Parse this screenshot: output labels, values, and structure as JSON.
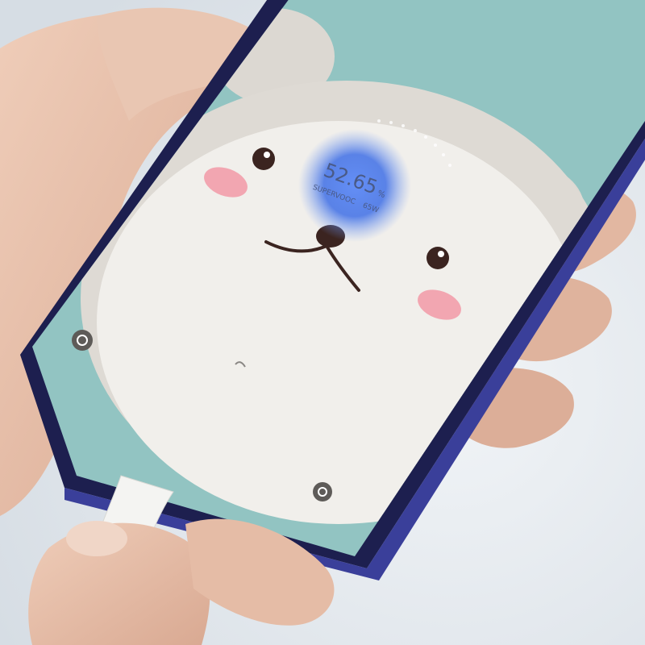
{
  "charging": {
    "percent": "52.65",
    "percent_unit": "%",
    "brand": "SUPERVOOC",
    "wattage": "65W"
  },
  "colors": {
    "wallpaper_sky": "#92c4c2",
    "bear_face": "#f1efeb",
    "bear_ear": "#dcd8d2",
    "cheek": "#f2a6b1",
    "charge_glow": "#3f6fe6",
    "phone_frame": "#2a2b6b",
    "skin": "#e7c3ae",
    "cable": "#f4f4f2"
  },
  "icons": {
    "top_left": "camera-shortcut-icon",
    "bottom_right": "camera-shortcut-icon"
  }
}
